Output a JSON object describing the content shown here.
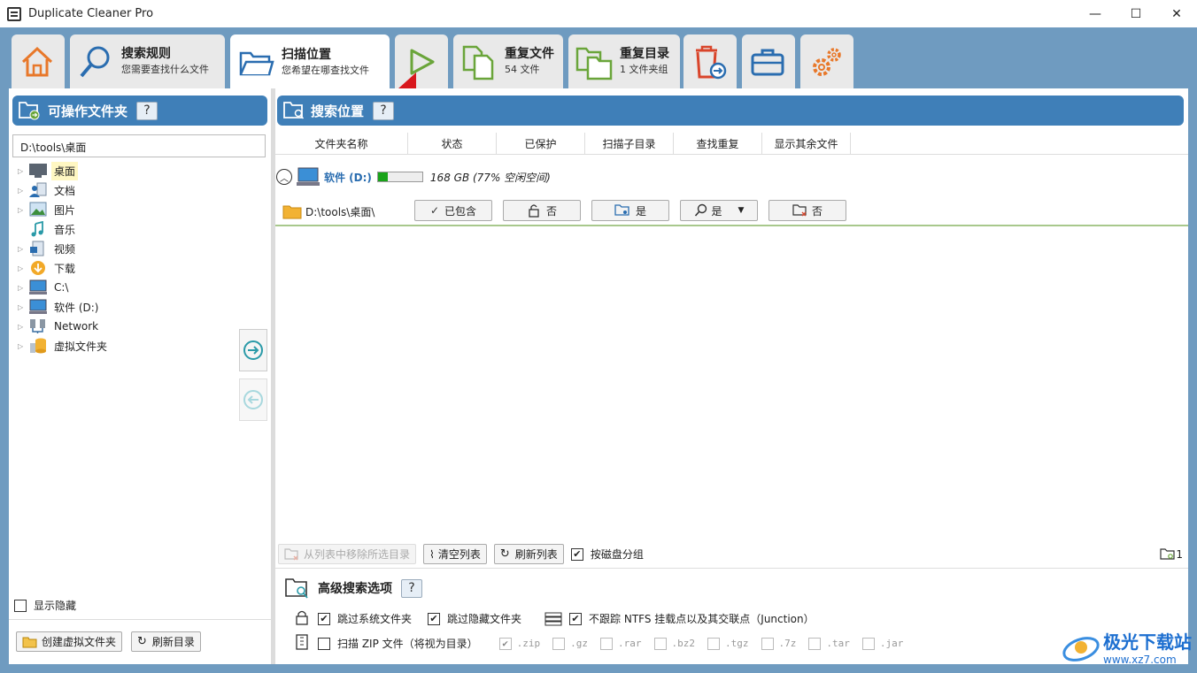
{
  "window": {
    "title": "Duplicate Cleaner Pro",
    "minimize": "—",
    "maximize": "☐",
    "close": "✕"
  },
  "tabs": [
    {
      "t1": "",
      "t2": "",
      "icon": "home-icon"
    },
    {
      "t1": "搜索规则",
      "t2": "您需要查找什么文件",
      "icon": "search-icon"
    },
    {
      "t1": "扫描位置",
      "t2": "您希望在哪查找文件",
      "icon": "folder-open-icon"
    },
    {
      "t1": "",
      "t2": "",
      "icon": "play-icon"
    },
    {
      "t1": "重复文件",
      "t2": "54 文件",
      "icon": "duplicate-files-icon"
    },
    {
      "t1": "重复目录",
      "t2": "1 文件夹组",
      "icon": "duplicate-folders-icon"
    },
    {
      "t1": "",
      "t2": "",
      "icon": "trash-move-icon"
    },
    {
      "t1": "",
      "t2": "",
      "icon": "toolbox-icon"
    },
    {
      "t1": "",
      "t2": "",
      "icon": "settings-gears-icon"
    }
  ],
  "left": {
    "header": "可操作文件夹",
    "help": "?",
    "path": "D:\\tools\\桌面",
    "tree": [
      {
        "label": "桌面",
        "icon": "desktop-icon",
        "selected": true
      },
      {
        "label": "文档",
        "icon": "documents-icon"
      },
      {
        "label": "图片",
        "icon": "pictures-icon"
      },
      {
        "label": "音乐",
        "icon": "music-icon"
      },
      {
        "label": "视频",
        "icon": "video-icon"
      },
      {
        "label": "下载",
        "icon": "download-icon"
      },
      {
        "label": "C:\\",
        "icon": "computer-icon"
      },
      {
        "label": "软件 (D:)",
        "icon": "computer-icon"
      },
      {
        "label": "Network",
        "icon": "network-icon"
      },
      {
        "label": "虚拟文件夹",
        "icon": "database-icon"
      }
    ],
    "show_hidden": "显示隐藏",
    "create_virtual": "创建虚拟文件夹",
    "refresh_dir": "刷新目录"
  },
  "right": {
    "header": "搜索位置",
    "help": "?",
    "columns": [
      "文件夹名称",
      "状态",
      "已保护",
      "扫描子目录",
      "查找重复",
      "显示其余文件"
    ],
    "drive": {
      "label": "软件 (D:)",
      "free": "168 GB (77% 空闲空间)",
      "used_fraction": 0.23
    },
    "folder": {
      "path": "D:\\tools\\桌面\\",
      "status": "已包含",
      "protected": "否",
      "subdirs": "是",
      "find_dups": "是",
      "show_rest": "否"
    },
    "toolbar": {
      "remove_selected": "从列表中移除所选目录",
      "clear_list": "清空列表",
      "refresh_list": "刷新列表",
      "group_by_disk": "按磁盘分组",
      "count": "1"
    },
    "advanced": {
      "title": "高级搜索选项",
      "help": "?",
      "skip_system": "跳过系统文件夹",
      "skip_hidden": "跳过隐藏文件夹",
      "no_ntfs": "不跟踪 NTFS 挂载点以及其交联点（Junction）",
      "scan_zip": "扫描 ZIP 文件（将视为目录）",
      "extensions": [
        ".zip",
        ".gz",
        ".rar",
        ".bz2",
        ".tgz",
        ".7z",
        ".tar",
        ".jar"
      ]
    }
  },
  "watermark": {
    "text": "极光下载站",
    "url": "www.xz7.com"
  }
}
